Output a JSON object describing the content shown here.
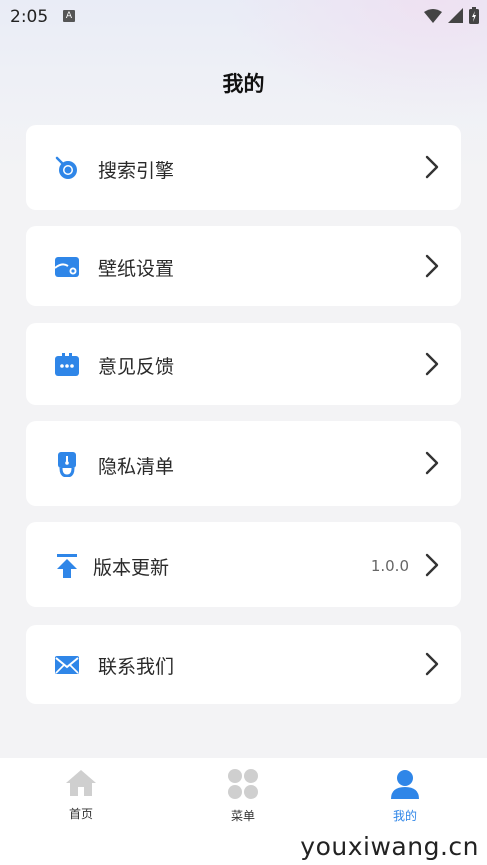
{
  "status": {
    "time": "2:05",
    "app_badge": "A"
  },
  "header": {
    "title": "我的"
  },
  "menu": [
    {
      "label": "搜索引擎",
      "icon": "search-engine-icon",
      "value": ""
    },
    {
      "label": "壁纸设置",
      "icon": "wallpaper-icon",
      "value": ""
    },
    {
      "label": "意见反馈",
      "icon": "feedback-icon",
      "value": ""
    },
    {
      "label": "隐私清单",
      "icon": "privacy-icon",
      "value": ""
    },
    {
      "label": "版本更新",
      "icon": "update-icon",
      "value": "1.0.0"
    },
    {
      "label": "联系我们",
      "icon": "mail-icon",
      "value": ""
    }
  ],
  "tabs": [
    {
      "label": "首页",
      "icon": "home-icon",
      "active": false
    },
    {
      "label": "菜单",
      "icon": "menu-grid-icon",
      "active": false
    },
    {
      "label": "我的",
      "icon": "profile-icon",
      "active": true
    }
  ],
  "watermark": "youxiwang.cn",
  "colors": {
    "accent": "#2f86e8",
    "card": "#ffffff",
    "background": "#f3f3f5"
  }
}
